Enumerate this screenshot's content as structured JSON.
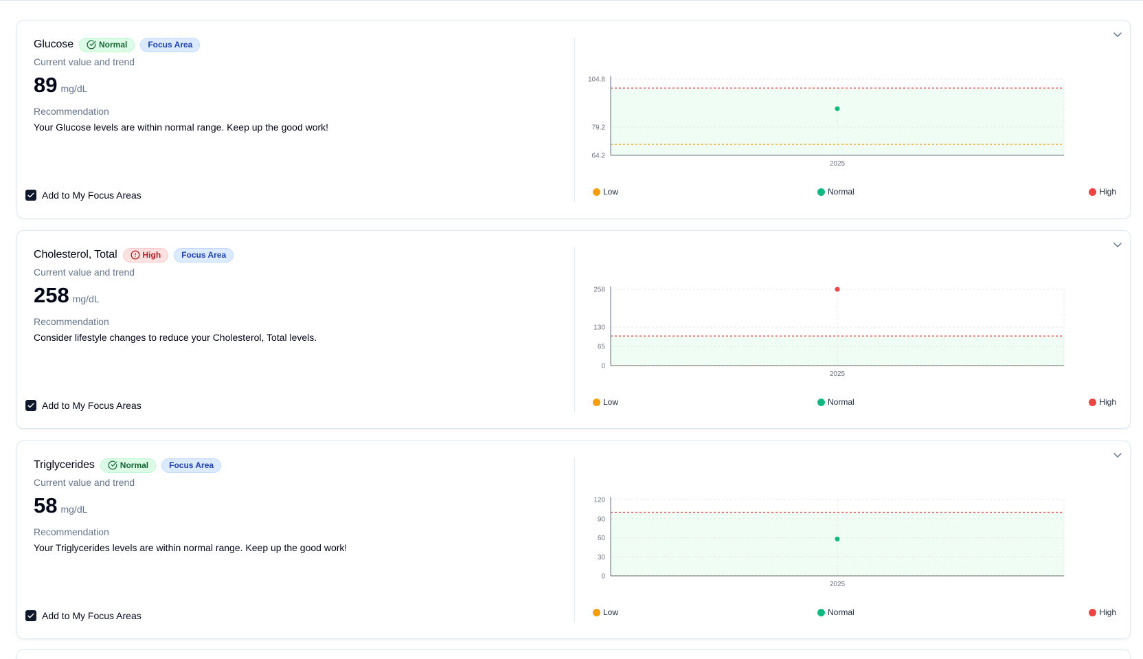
{
  "colors": {
    "low": "#f59e0b",
    "normal": "#10b981",
    "high": "#ef4444",
    "range_fill": "#f0fdf4",
    "axis": "#94a3b8"
  },
  "shared": {
    "subtitle": "Current value and trend",
    "recommendation_label": "Recommendation",
    "focus_badge": "Focus Area",
    "checkbox_label": "Add to My Focus Areas",
    "legend": {
      "low": "Low",
      "normal": "Normal",
      "high": "High"
    }
  },
  "metrics": [
    {
      "name": "Glucose",
      "status": "Normal",
      "status_icon": "circle-check-icon",
      "value": "89",
      "unit": "mg/dL",
      "recommendation": "Your Glucose levels are within normal range. Keep up the good work!",
      "focus_checked": true,
      "chart_data": {
        "type": "scatter",
        "x": [
          "2025"
        ],
        "series": [
          {
            "values": [
              89
            ],
            "color": "#10b981"
          }
        ],
        "ylim": [
          64.2,
          104.8
        ],
        "yticks": [
          "104.8",
          "79.2",
          "64.2"
        ],
        "ytick_values": [
          104.8,
          79.2,
          64.2
        ],
        "reference_lines": {
          "high": 100,
          "low": 70
        },
        "normal_range": [
          64.2,
          100
        ],
        "grid": true
      }
    },
    {
      "name": "Cholesterol, Total",
      "status": "High",
      "status_icon": "alert-circle-icon",
      "value": "258",
      "unit": "mg/dL",
      "recommendation": "Consider lifestyle changes to reduce your Cholesterol, Total levels.",
      "focus_checked": true,
      "chart_data": {
        "type": "scatter",
        "x": [
          "2025"
        ],
        "series": [
          {
            "values": [
              258
            ],
            "color": "#ef4444"
          }
        ],
        "ylim": [
          0,
          258
        ],
        "yticks": [
          "258",
          "130",
          "65",
          "0"
        ],
        "ytick_values": [
          258,
          130,
          65,
          0
        ],
        "reference_lines": {
          "high": 100,
          "low": 0
        },
        "normal_range": [
          0,
          100
        ],
        "grid": true
      }
    },
    {
      "name": "Triglycerides",
      "status": "Normal",
      "status_icon": "circle-check-icon",
      "value": "58",
      "unit": "mg/dL",
      "recommendation": "Your Triglycerides levels are within normal range. Keep up the good work!",
      "focus_checked": true,
      "chart_data": {
        "type": "scatter",
        "x": [
          "2025"
        ],
        "series": [
          {
            "values": [
              58
            ],
            "color": "#10b981"
          }
        ],
        "ylim": [
          0,
          120
        ],
        "yticks": [
          "120",
          "90",
          "60",
          "30",
          "0"
        ],
        "ytick_values": [
          120,
          90,
          60,
          30,
          0
        ],
        "reference_lines": {
          "high": 100,
          "low": 0
        },
        "normal_range": [
          0,
          100
        ],
        "grid": true
      }
    }
  ]
}
